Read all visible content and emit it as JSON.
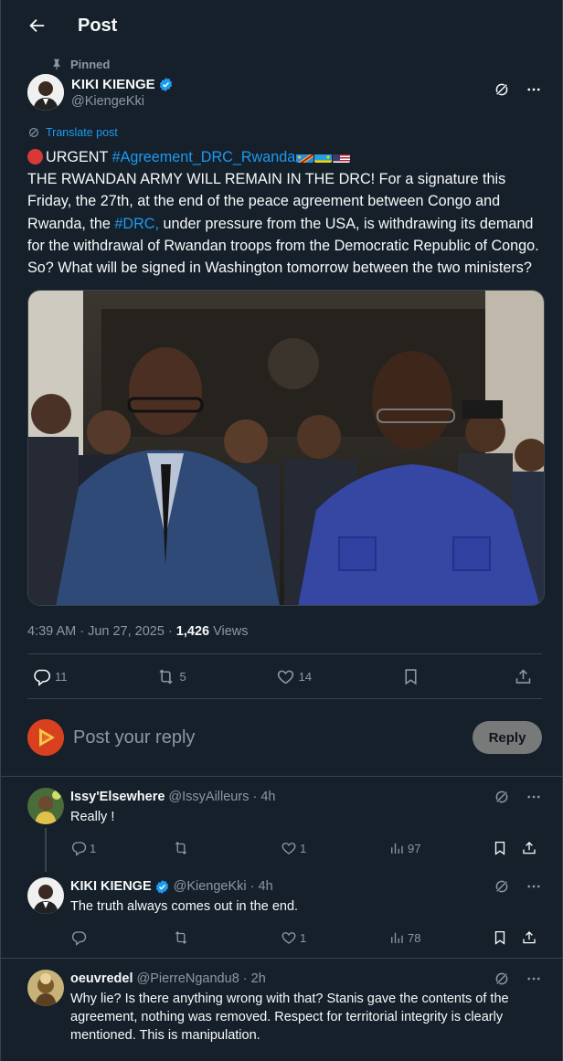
{
  "header": {
    "title": "Post"
  },
  "post": {
    "pinned_label": "Pinned",
    "author": {
      "name": "KIKI KIENGE",
      "handle": "@KiengeKki"
    },
    "translate_label": "Translate post",
    "text": {
      "urgent": "URGENT",
      "hashtag1": "#Agreement_DRC_Rwanda",
      "line1": "THE RWANDAN ARMY WILL REMAIN IN THE DRC! For a signature this Friday, the 27th, at the end of the peace agreement between Congo and Rwanda, the",
      "hashtag2": "#DRC,",
      "line2": "under pressure from the USA, is withdrawing its demand for the withdrawal of Rwandan troops from the Democratic Republic of Congo. So? What will be signed in Washington tomorrow between the two ministers?"
    },
    "timestamp": "4:39 AM · Jun 27, 2025 ·",
    "views_count": "1,426",
    "views_label": "Views",
    "stats": {
      "replies": "11",
      "reposts": "5",
      "likes": "14"
    }
  },
  "reply_box": {
    "placeholder": "Post your reply",
    "button_label": "Reply"
  },
  "replies": [
    {
      "name": "Issy'Elsewhere",
      "handle": "@IssyAilleurs · 4h",
      "text": "Really !",
      "stats": {
        "replies": "1",
        "reposts": "",
        "likes": "1",
        "views": "97"
      }
    },
    {
      "name": "KIKI KIENGE",
      "handle": "@KiengeKki · 4h",
      "text": "The truth always comes out in the end.",
      "stats": {
        "replies": "",
        "reposts": "",
        "likes": "1",
        "views": "78"
      }
    },
    {
      "name": "oeuvredel",
      "handle": "@PierreNgandu8 · 2h",
      "text": "Why lie? Is there anything wrong with that? Stanis gave the contents of the agreement, nothing was removed. Respect for territorial integrity is clearly mentioned. This is manipulation."
    }
  ],
  "colors": {
    "background": "#15202b",
    "accent": "#1d9bf0",
    "muted": "#8b98a5",
    "divider": "#38444d"
  }
}
